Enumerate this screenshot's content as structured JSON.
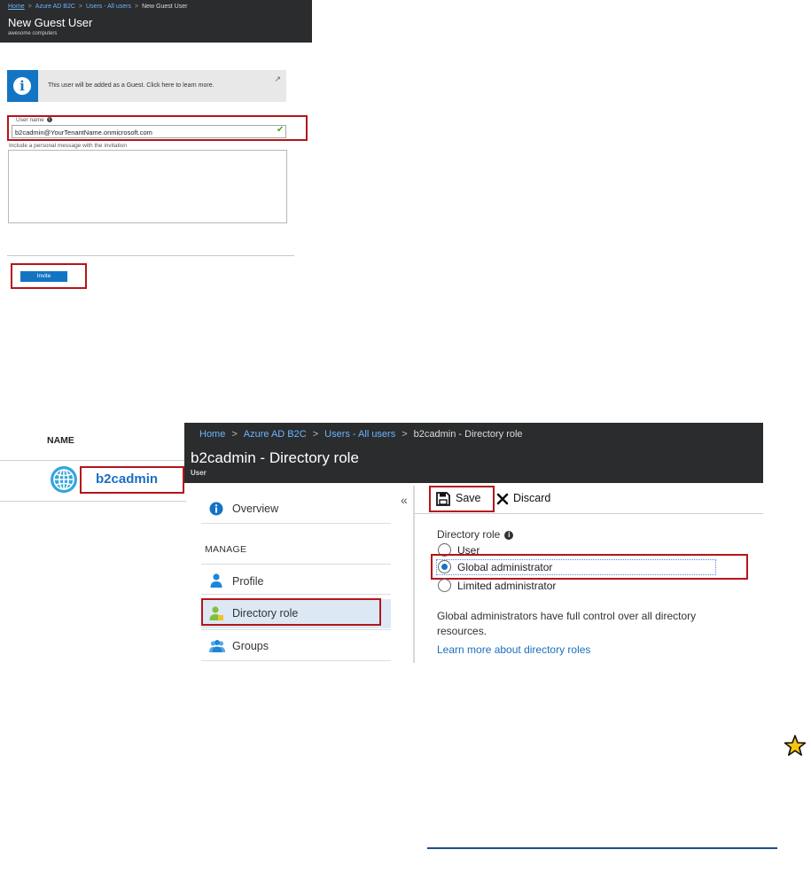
{
  "guest_panel": {
    "breadcrumbs": [
      "Home",
      "Azure AD B2C",
      "Users - All users",
      "New Guest User"
    ],
    "title": "New Guest User",
    "subtitle": "awesome computers",
    "info_message": "This user will be added as a Guest. Click here to learn more.",
    "username_label": "User name",
    "username_value": "b2cadmin@YourTenantName.onmicrosoft.com",
    "message_label": "Include a personal message with the invitation",
    "message_value": "",
    "invite_label": "Invite"
  },
  "user_list": {
    "column_header": "NAME",
    "rows": [
      {
        "name": "b2cadmin",
        "icon": "globe-icon"
      }
    ]
  },
  "directory_role_panel": {
    "breadcrumbs": [
      "Home",
      "Azure AD B2C",
      "Users - All users",
      "b2cadmin - Directory role"
    ],
    "title": "b2cadmin - Directory role",
    "subtitle": "User",
    "collapse_glyph": "«",
    "nav": {
      "overview": "Overview",
      "manage_header": "MANAGE",
      "profile": "Profile",
      "directory_role": "Directory role",
      "groups": "Groups"
    },
    "toolbar": {
      "save": "Save",
      "discard": "Discard"
    },
    "role_label": "Directory role",
    "options": [
      "User",
      "Global administrator",
      "Limited administrator"
    ],
    "selected_option": "Global administrator",
    "description": "Global administrators have full control over all directory resources.",
    "learn_more": "Learn more about directory roles"
  },
  "colors": {
    "header_bg": "#2a2c2d",
    "accent": "#1474c4",
    "highlight_box": "#b4151b",
    "link": "#1c6fc0",
    "selected_nav_bg": "#dce9f5"
  }
}
